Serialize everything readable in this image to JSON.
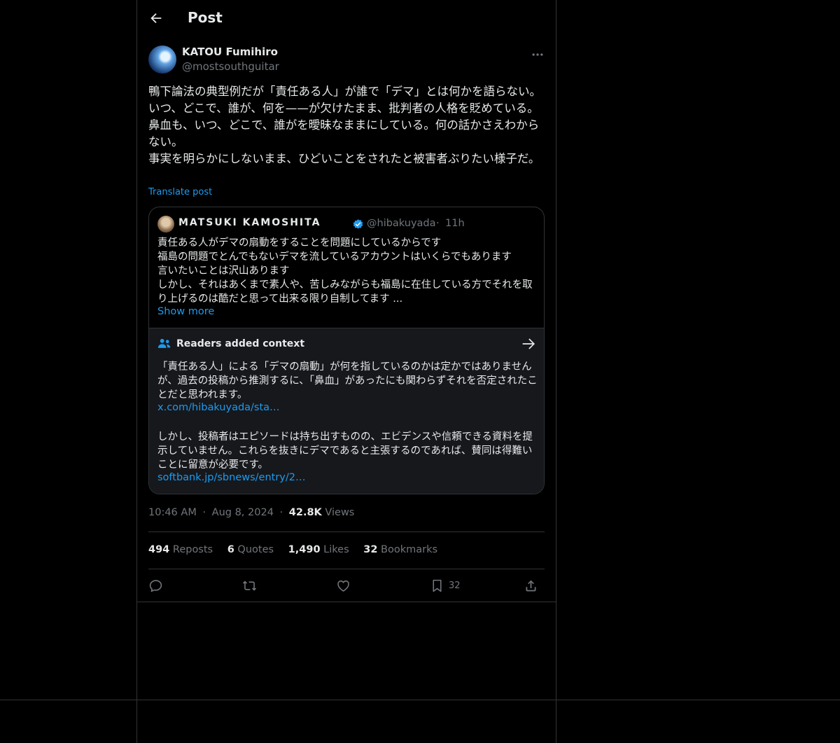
{
  "header": {
    "title": "Post"
  },
  "author": {
    "name": "KATOU Fumihiro",
    "handle": "@mostsouthguitar"
  },
  "post": {
    "text": "鴨下論法の典型例だが「責任ある人」が誰で「デマ」とは何かを語らない。いつ、どこで、誰が、何を——が欠けたまま、批判者の人格を貶めている。鼻血も、いつ、どこで、誰がを曖昧なままにしている。何の話かさえわからない。\n事実を明らかにしないまま、ひどいことをされたと被害者ぶりたい様子だ。",
    "translate": "Translate post"
  },
  "quote": {
    "name": "MATSUKI KAMOSHITA",
    "handle": "@hibakuyada",
    "sep": "·",
    "time": "11h",
    "text": "責任ある人がデマの扇動をすることを問題にしているからです\n福島の問題でとんでもないデマを流しているアカウントはいくらでもあります\n言いたいことは沢山あります\nしかし、それはあくまで素人や、苦しみながらも福島に在住している方でそれを取り上げるのは酷だと思って出来る限り自制してます ...",
    "show_more": "Show more"
  },
  "context": {
    "title": "Readers added context",
    "p1": "「責任ある人」による「デマの扇動」が何を指しているのかは定かではありませんが、過去の投稿から推測するに、「鼻血」があったにも関わらずそれを否定されたことだと思われます。",
    "link1": "x.com/hibakuyada/sta…",
    "p2": "しかし、投稿者はエピソードは持ち出すものの、エビデンスや信頼できる資料を提示していません。これらを抜きにデマであると主張するのであれば、賛同は得難いことに留意が必要です。",
    "link2": "softbank.jp/sbnews/entry/2…"
  },
  "meta": {
    "time": "10:46 AM",
    "date": "Aug 8, 2024",
    "views_count": "42.8K",
    "views_label": "Views",
    "sep": "·"
  },
  "stats": {
    "reposts": {
      "count": "494",
      "label": "Reposts"
    },
    "quotes": {
      "count": "6",
      "label": "Quotes"
    },
    "likes": {
      "count": "1,490",
      "label": "Likes"
    },
    "bookmarks": {
      "count": "32",
      "label": "Bookmarks"
    }
  },
  "actions": {
    "bookmark_count": "32"
  },
  "colors": {
    "background": "#000000",
    "text": "#e7e9ea",
    "muted": "#71767b",
    "accent": "#1d9bf0",
    "border": "#2f3336",
    "context_bg": "#16181c"
  },
  "icons": [
    "back-arrow-icon",
    "more-icon",
    "verified-icon",
    "people-icon",
    "arrow-right-icon",
    "reply-icon",
    "repost-icon",
    "like-icon",
    "bookmark-icon",
    "share-icon"
  ]
}
